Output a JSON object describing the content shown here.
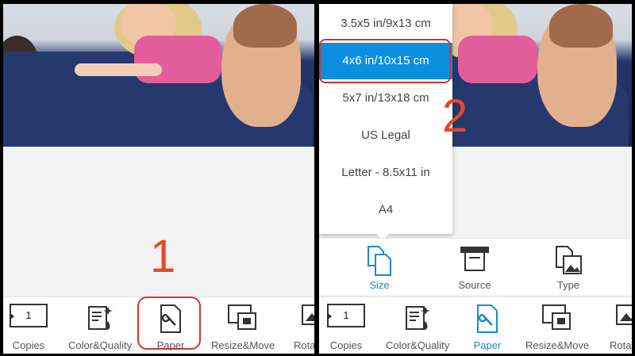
{
  "toolbar": {
    "items": [
      {
        "label": "Copies",
        "icon": "copies-icon",
        "value": "1"
      },
      {
        "label": "Color&Quality",
        "icon": "color-quality-icon"
      },
      {
        "label": "Paper",
        "icon": "paper-wrench-icon"
      },
      {
        "label": "Resize&Move",
        "icon": "resize-move-icon"
      },
      {
        "label": "Rota",
        "icon": "rotate-icon"
      }
    ]
  },
  "paper_menu": {
    "options": [
      "3.5x5 in/9x13 cm",
      "4x6 in/10x15 cm",
      "5x7 in/13x18 cm",
      "US Legal",
      "Letter - 8.5x11 in",
      "A4"
    ],
    "selected": "4x6 in/10x15 cm"
  },
  "paper_subtabs": [
    {
      "label": "Size",
      "icon": "size-icon"
    },
    {
      "label": "Source",
      "icon": "source-tray-icon"
    },
    {
      "label": "Type",
      "icon": "paper-type-icon"
    }
  ],
  "steps": {
    "first": "1",
    "second": "2"
  },
  "colors": {
    "accent": "#1a8ad4",
    "highlight": "#d9312b",
    "step_number": "#e2492b",
    "selected_bg": "#0d8fe0"
  }
}
